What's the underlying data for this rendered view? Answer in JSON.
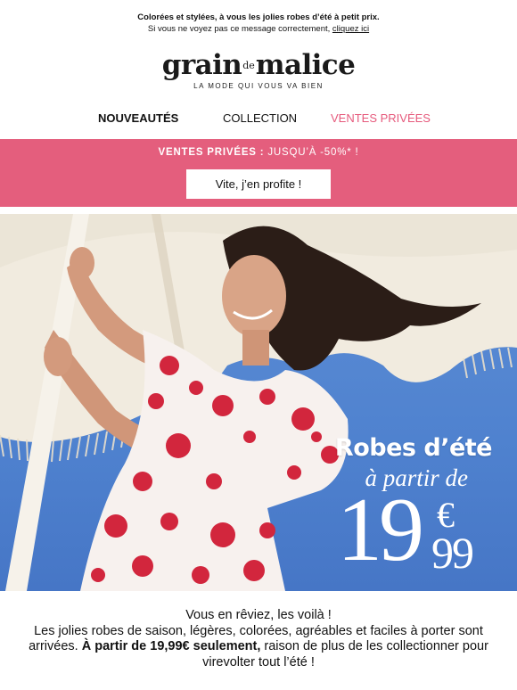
{
  "preheader": {
    "line1": "Colorées et stylées, à vous les jolies robes d’été à petit prix.",
    "line2_text": "Si vous ne voyez pas ce message correctement, ",
    "line2_link": "cliquez ici"
  },
  "logo": {
    "part1": "grain",
    "part_small": "de",
    "part2": "malice",
    "tagline": "LA MODE QUI VOUS VA BIEN"
  },
  "nav": {
    "items": [
      {
        "label": "NOUVEAUTÉS"
      },
      {
        "label": "COLLECTION"
      },
      {
        "label": "VENTES PRIVÉES"
      }
    ]
  },
  "promo": {
    "title_bold": "VENTES PRIVÉES :",
    "title_rest": " JUSQU’À -50%* !",
    "cta": "Vite, j’en profite !"
  },
  "hero": {
    "headline": "Robes d’été",
    "subheadline": "à partir de",
    "price_main": "19",
    "price_currency": "€",
    "price_cents": "99"
  },
  "body": {
    "line1": "Vous en rêviez, les voilà !",
    "line2": "Les jolies robes de saison, légères, colorées, agréables et faciles à porter sont arrivées. ",
    "bold": "À partir de 19,99€ seulement,",
    "line3": " raison de plus de les collectionner pour virevolter tout l’été !"
  },
  "colors": {
    "promo_bg": "#e45e7d",
    "nav_accent": "#e65a7c",
    "sky": "#4f82cf"
  }
}
